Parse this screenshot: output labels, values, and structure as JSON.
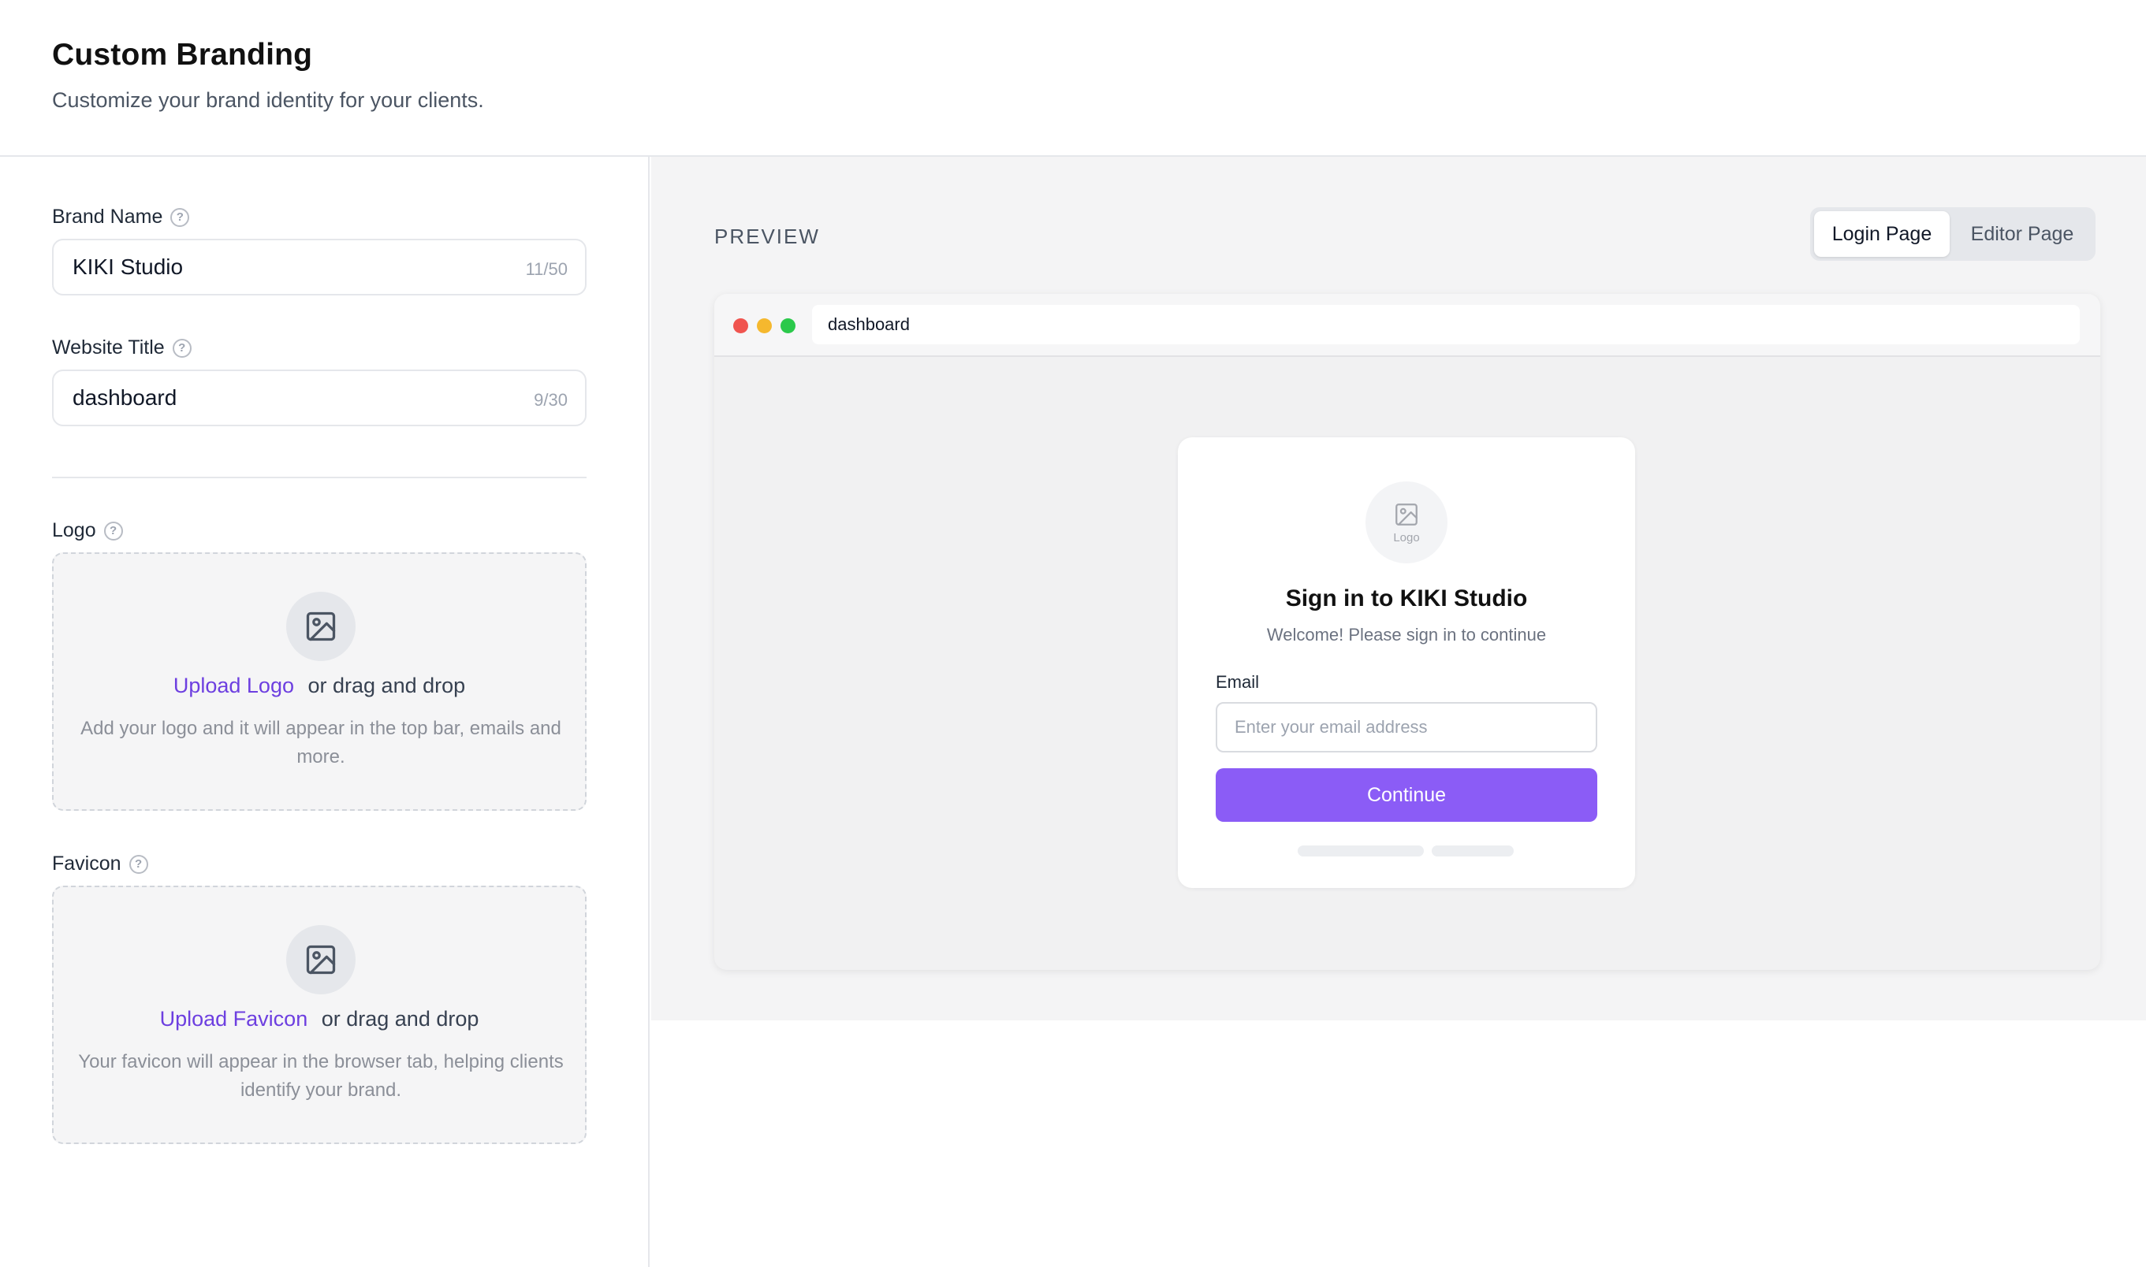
{
  "header": {
    "title": "Custom Branding",
    "subtitle": "Customize your brand identity for your clients."
  },
  "form": {
    "brand_name": {
      "label": "Brand Name",
      "value": "KIKI Studio",
      "counter": "11/50"
    },
    "website_title": {
      "label": "Website Title",
      "value": "dashboard",
      "counter": "9/30"
    },
    "logo": {
      "label": "Logo",
      "upload_link": "Upload Logo",
      "upload_suffix": "or drag and drop",
      "help_text": "Add your logo and it will appear in the top bar, emails and more."
    },
    "favicon": {
      "label": "Favicon",
      "upload_link": "Upload Favicon",
      "upload_suffix": "or drag and drop",
      "help_text": "Your favicon will appear in the browser tab, helping clients identify your brand."
    },
    "help_glyph": "?"
  },
  "preview": {
    "label": "PREVIEW",
    "tabs": [
      {
        "label": "Login Page",
        "active": true
      },
      {
        "label": "Editor Page",
        "active": false
      }
    ],
    "browser": {
      "address": "dashboard",
      "login": {
        "logo_text": "Logo",
        "title": "Sign in to KIKI Studio",
        "subtitle": "Welcome! Please sign in to continue",
        "email_label": "Email",
        "email_placeholder": "Enter your email address",
        "continue_label": "Continue"
      }
    }
  },
  "colors": {
    "accent": "#6d3fe0",
    "button": "#8b5cf6",
    "dot_red": "#f0544f",
    "dot_yellow": "#f5b82e",
    "dot_green": "#2bc94b"
  }
}
